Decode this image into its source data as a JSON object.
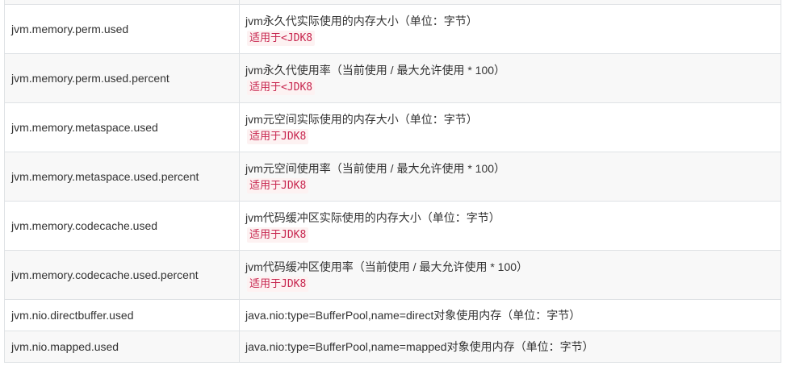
{
  "rows": [
    {
      "name": "jvm.memory.perm.used",
      "desc": "jvm永久代实际使用的内存大小（单位：字节）",
      "tag": "适用于<JDK8"
    },
    {
      "name": "jvm.memory.perm.used.percent",
      "desc": "jvm永久代使用率（当前使用 / 最大允许使用 * 100）",
      "tag": "适用于<JDK8"
    },
    {
      "name": "jvm.memory.metaspace.used",
      "desc": "jvm元空间实际使用的内存大小（单位：字节）",
      "tag": "适用于JDK8"
    },
    {
      "name": "jvm.memory.metaspace.used.percent",
      "desc": "jvm元空间使用率（当前使用 / 最大允许使用 * 100）",
      "tag": "适用于JDK8"
    },
    {
      "name": "jvm.memory.codecache.used",
      "desc": "jvm代码缓冲区实际使用的内存大小（单位：字节）",
      "tag": "适用于JDK8"
    },
    {
      "name": "jvm.memory.codecache.used.percent",
      "desc": "jvm代码缓冲区使用率（当前使用 / 最大允许使用 * 100）",
      "tag": "适用于JDK8"
    },
    {
      "name": "jvm.nio.directbuffer.used",
      "desc": "java.nio:type=BufferPool,name=direct对象使用内存（单位：字节）"
    },
    {
      "name": "jvm.nio.mapped.used",
      "desc": "java.nio:type=BufferPool,name=mapped对象使用内存（单位：字节）"
    }
  ],
  "colors": {
    "border": "#dfe2e5",
    "stripe": "#f8f8f8",
    "text": "#333333",
    "tag_text": "#c7254e",
    "tag_bg": "#fdf2f2"
  }
}
